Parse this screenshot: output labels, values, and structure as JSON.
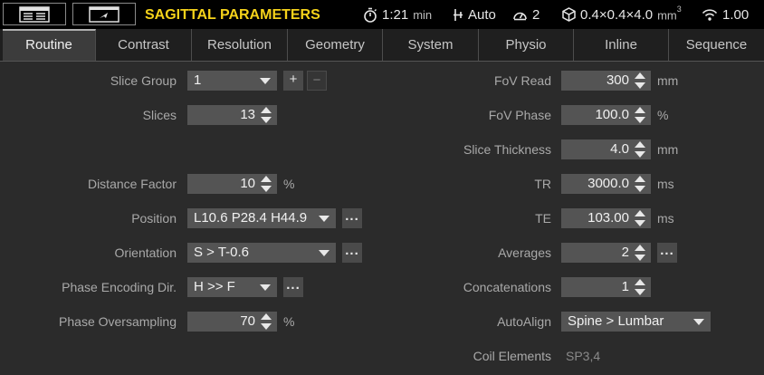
{
  "header": {
    "title": "SAGITTAL PARAMETERS",
    "time": "1:21",
    "time_unit": "min",
    "mode": "Auto",
    "count": "2",
    "voxel": "0.4×0.4×4.0",
    "voxel_unit": "mm",
    "voxel_unit_sup": "3",
    "signal": "1.00"
  },
  "tabs": [
    {
      "label": "Routine",
      "active": true
    },
    {
      "label": "Contrast"
    },
    {
      "label": "Resolution"
    },
    {
      "label": "Geometry"
    },
    {
      "label": "System"
    },
    {
      "label": "Physio"
    },
    {
      "label": "Inline"
    },
    {
      "label": "Sequence"
    }
  ],
  "left": {
    "slice_group": {
      "label": "Slice Group",
      "value": "1",
      "add": "+",
      "remove": "−"
    },
    "slices": {
      "label": "Slices",
      "value": "13"
    },
    "distance_factor": {
      "label": "Distance Factor",
      "value": "10",
      "unit": "%"
    },
    "position": {
      "label": "Position",
      "value": "L10.6 P28.4 H44.9",
      "more": "..."
    },
    "orientation": {
      "label": "Orientation",
      "value": "S > T-0.6",
      "more": "..."
    },
    "phase_encoding": {
      "label": "Phase Encoding Dir.",
      "value": "H >> F",
      "more": "..."
    },
    "phase_oversampling": {
      "label": "Phase Oversampling",
      "value": "70",
      "unit": "%"
    }
  },
  "right": {
    "fov_read": {
      "label": "FoV Read",
      "value": "300",
      "unit": "mm"
    },
    "fov_phase": {
      "label": "FoV Phase",
      "value": "100.0",
      "unit": "%"
    },
    "slice_thickness": {
      "label": "Slice Thickness",
      "value": "4.0",
      "unit": "mm"
    },
    "tr": {
      "label": "TR",
      "value": "3000.0",
      "unit": "ms"
    },
    "te": {
      "label": "TE",
      "value": "103.00",
      "unit": "ms"
    },
    "averages": {
      "label": "Averages",
      "value": "2",
      "more": "..."
    },
    "concatenations": {
      "label": "Concatenations",
      "value": "1"
    },
    "autoalign": {
      "label": "AutoAlign",
      "value": "Spine > Lumbar"
    },
    "coil_elements": {
      "label": "Coil Elements",
      "value": "SP3,4"
    }
  },
  "colors": {
    "title": "#f5d21a",
    "header_bg": "#000000",
    "panel_bg": "#2b2b2b",
    "field_bg": "#545454"
  },
  "icons": [
    "layout-icon",
    "arrow-box-icon",
    "stopwatch-icon",
    "table-move-icon",
    "gauge-icon",
    "cube-icon",
    "signal-icon"
  ]
}
